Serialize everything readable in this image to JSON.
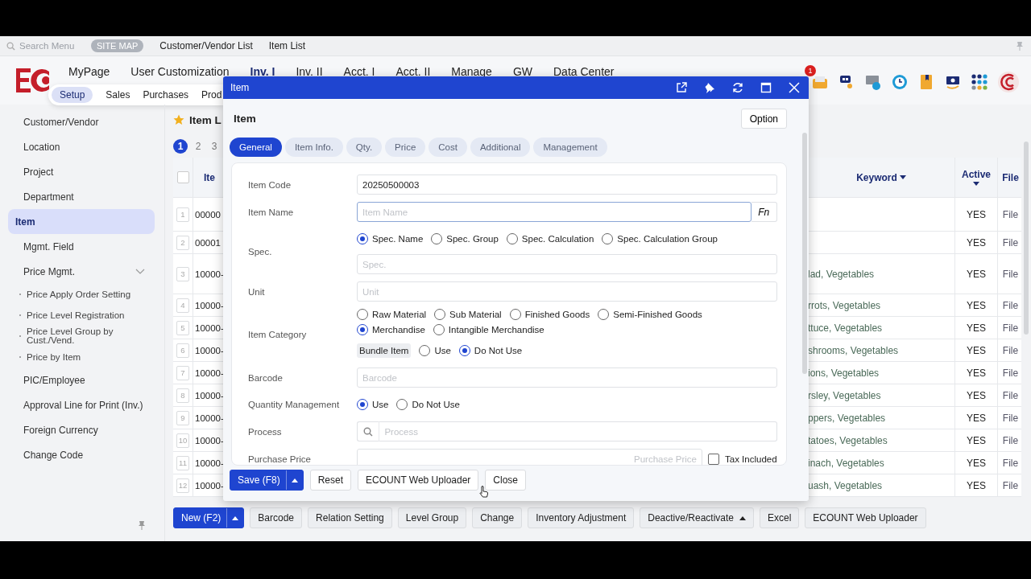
{
  "top_bar": {
    "search_placeholder": "Search Menu",
    "site_map": "SITE MAP",
    "open_tabs": [
      "Customer/Vendor List",
      "Item List"
    ]
  },
  "main_menu": [
    {
      "label": "MyPage",
      "selected": false
    },
    {
      "label": "User Customization",
      "selected": false
    },
    {
      "label": "Inv. I",
      "selected": true
    },
    {
      "label": "Inv. II",
      "selected": false
    },
    {
      "label": "Acct. I",
      "selected": false
    },
    {
      "label": "Acct. II",
      "selected": false
    },
    {
      "label": "Manage",
      "selected": false
    },
    {
      "label": "GW",
      "selected": false
    },
    {
      "label": "Data Center",
      "selected": false
    }
  ],
  "notification_badge": "1",
  "sub_menu": [
    {
      "label": "Setup",
      "selected": true
    },
    {
      "label": "Sales",
      "selected": false
    },
    {
      "label": "Purchases",
      "selected": false
    },
    {
      "label": "Prod",
      "selected": false
    }
  ],
  "sidebar": {
    "items": [
      {
        "label": "Customer/Vendor",
        "selected": false
      },
      {
        "label": "Location",
        "selected": false
      },
      {
        "label": "Project",
        "selected": false
      },
      {
        "label": "Department",
        "selected": false
      },
      {
        "label": "Item",
        "selected": true
      },
      {
        "label": "Mgmt. Field",
        "selected": false
      },
      {
        "label": "Price Mgmt.",
        "selected": false,
        "expanded": true,
        "children": [
          {
            "label": "Price Apply Order Setting",
            "selected": false
          },
          {
            "label": "Price Level Registration",
            "selected": false
          },
          {
            "label": "Price Level Group by Cust./Vend.",
            "selected": false
          },
          {
            "label": "Price by Item",
            "selected": false
          }
        ]
      },
      {
        "label": "PIC/Employee",
        "selected": false
      },
      {
        "label": "Approval Line for Print (Inv.)",
        "selected": false
      },
      {
        "label": "Foreign Currency",
        "selected": false
      },
      {
        "label": "Change Code",
        "selected": false
      }
    ]
  },
  "item_list": {
    "title": "Item L",
    "pages": [
      {
        "label": "1",
        "selected": true
      },
      {
        "label": "2",
        "selected": false
      },
      {
        "label": "3",
        "selected": false
      }
    ],
    "select_all_checked": false,
    "columns": [
      {
        "label": "Ite",
        "sortable": false
      },
      {
        "label": "Keyword",
        "sortable": true
      },
      {
        "label": "Active",
        "sortable": true
      },
      {
        "label": "File",
        "sortable": false
      }
    ],
    "rows": [
      {
        "no": "1",
        "code": "00000",
        "active": "YES",
        "file": "File"
      },
      {
        "no": "2",
        "code": "00001",
        "active": "YES",
        "file": "File"
      },
      {
        "no": "3",
        "code": "10000-",
        "keyword": "lad, Vegetables",
        "active": "YES",
        "file": "File"
      },
      {
        "no": "4",
        "code": "10000-",
        "keyword": "rrots, Vegetables",
        "active": "YES",
        "file": "File"
      },
      {
        "no": "5",
        "code": "10000-",
        "keyword": "ttuce, Vegetables",
        "active": "YES",
        "file": "File"
      },
      {
        "no": "6",
        "code": "10000-",
        "keyword": "shrooms, Vegetables",
        "active": "YES",
        "file": "File"
      },
      {
        "no": "7",
        "code": "10000-",
        "keyword": "ions, Vegetables",
        "active": "YES",
        "file": "File"
      },
      {
        "no": "8",
        "code": "10000-",
        "keyword": "rsley, Vegetables",
        "active": "YES",
        "file": "File"
      },
      {
        "no": "9",
        "code": "10000-",
        "keyword": "ppers, Vegetables",
        "active": "YES",
        "file": "File"
      },
      {
        "no": "10",
        "code": "10000-",
        "keyword": "tatoes, Vegetables",
        "active": "YES",
        "file": "File"
      },
      {
        "no": "11",
        "code": "10000-",
        "keyword": "inach, Vegetables",
        "active": "YES",
        "file": "File"
      },
      {
        "no": "12",
        "code": "10000-",
        "keyword": "uash, Vegetables",
        "active": "YES",
        "file": "File"
      }
    ]
  },
  "toolbar": [
    {
      "label": "New (F2)",
      "kind": "primary-split"
    },
    {
      "label": "Barcode",
      "kind": "plain"
    },
    {
      "label": "Relation Setting",
      "kind": "plain"
    },
    {
      "label": "Level Group",
      "kind": "plain"
    },
    {
      "label": "Change",
      "kind": "plain"
    },
    {
      "label": "Inventory Adjustment",
      "kind": "plain"
    },
    {
      "label": "Deactive/Reactivate",
      "kind": "dropdown"
    },
    {
      "label": "Excel",
      "kind": "plain"
    },
    {
      "label": "ECOUNT Web Uploader",
      "kind": "plain"
    }
  ],
  "modal": {
    "title": "Item",
    "heading": "Item",
    "option_button": "Option",
    "tabs": [
      {
        "label": "General",
        "selected": true
      },
      {
        "label": "Item Info.",
        "selected": false
      },
      {
        "label": "Qty.",
        "selected": false
      },
      {
        "label": "Price",
        "selected": false
      },
      {
        "label": "Cost",
        "selected": false
      },
      {
        "label": "Additional",
        "selected": false
      },
      {
        "label": "Management",
        "selected": false
      }
    ],
    "fields": [
      {
        "label": "Item Code",
        "kind": "text",
        "value": "20250500003",
        "focused": false
      },
      {
        "label": "Item Name",
        "kind": "text",
        "placeholder": "Item Name",
        "focused": true,
        "suffix": "Fn"
      },
      {
        "label": "Spec.",
        "kind": "radio-text",
        "options": [
          {
            "label": "Spec. Name",
            "selected": true
          },
          {
            "label": "Spec. Group",
            "selected": false
          },
          {
            "label": "Spec. Calculation",
            "selected": false
          },
          {
            "label": "Spec. Calculation Group",
            "selected": false
          }
        ],
        "placeholder": "Spec."
      },
      {
        "label": "Unit",
        "kind": "text",
        "placeholder": "Unit",
        "focused": false
      },
      {
        "label": "Item Category",
        "kind": "radio-bundle",
        "options": [
          {
            "label": "Raw Material",
            "selected": false
          },
          {
            "label": "Sub Material",
            "selected": false
          },
          {
            "label": "Finished Goods",
            "selected": false
          },
          {
            "label": "Semi-Finished Goods",
            "selected": false
          },
          {
            "label": "Merchandise",
            "selected": true
          },
          {
            "label": "Intangible Merchandise",
            "selected": false
          }
        ],
        "bundle": {
          "tag": "Bundle Item",
          "options": [
            {
              "label": "Use",
              "selected": false
            },
            {
              "label": "Do Not Use",
              "selected": true
            }
          ]
        }
      },
      {
        "label": "Barcode",
        "kind": "text",
        "placeholder": "Barcode",
        "focused": false
      },
      {
        "label": "Quantity Management",
        "kind": "radio",
        "options": [
          {
            "label": "Use",
            "selected": true
          },
          {
            "label": "Do Not Use",
            "selected": false
          }
        ]
      },
      {
        "label": "Process",
        "kind": "search",
        "placeholder": "Process"
      },
      {
        "label": "Purchase Price",
        "kind": "price",
        "placeholder": "Purchase Price",
        "checkbox": {
          "label": "Tax Included",
          "checked": false
        }
      }
    ],
    "footer": [
      {
        "label": "Save (F8)",
        "kind": "primary-split"
      },
      {
        "label": "Reset",
        "kind": "plain"
      },
      {
        "label": "ECOUNT Web Uploader",
        "kind": "plain"
      },
      {
        "label": "Close",
        "kind": "plain"
      }
    ]
  }
}
